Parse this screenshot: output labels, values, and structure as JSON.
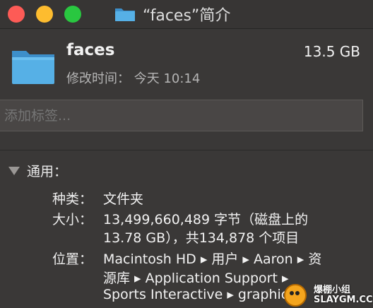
{
  "window": {
    "title": "“faces”简介"
  },
  "colors": {
    "folder_blue": "#56b0e6",
    "folder_blue_dark": "#3d8fca",
    "accent_red": "#fd5b56",
    "accent_yellow": "#fdbc2f",
    "accent_green": "#29c740"
  },
  "icons": {
    "close": "close-icon",
    "minimize": "minimize-icon",
    "zoom": "zoom-icon",
    "folder": "folder-icon",
    "disclosure": "disclosure-triangle-icon"
  },
  "header": {
    "name": "faces",
    "size": "13.5 GB",
    "modified": "修改时间： 今天 10:14"
  },
  "tags": {
    "placeholder": "添加标签..."
  },
  "general": {
    "title": "通用：",
    "kind_label": "种类：",
    "kind_value": "文件夹",
    "size_label": "大小：",
    "size_line1": "13,499,660,489 字节（磁盘上的",
    "size_line2": "13.78 GB），共134,878 个项目",
    "where_label": "位置：",
    "where_line1": "Macintosh HD ▸ 用户 ▸ Aaron ▸ 资",
    "where_line2": "源库 ▸ Application Support ▸",
    "where_line3": "Sports Interactive ▸ graphics"
  },
  "watermark": {
    "line1": "爆棚小组",
    "line2": "SLAYGM.CC"
  }
}
